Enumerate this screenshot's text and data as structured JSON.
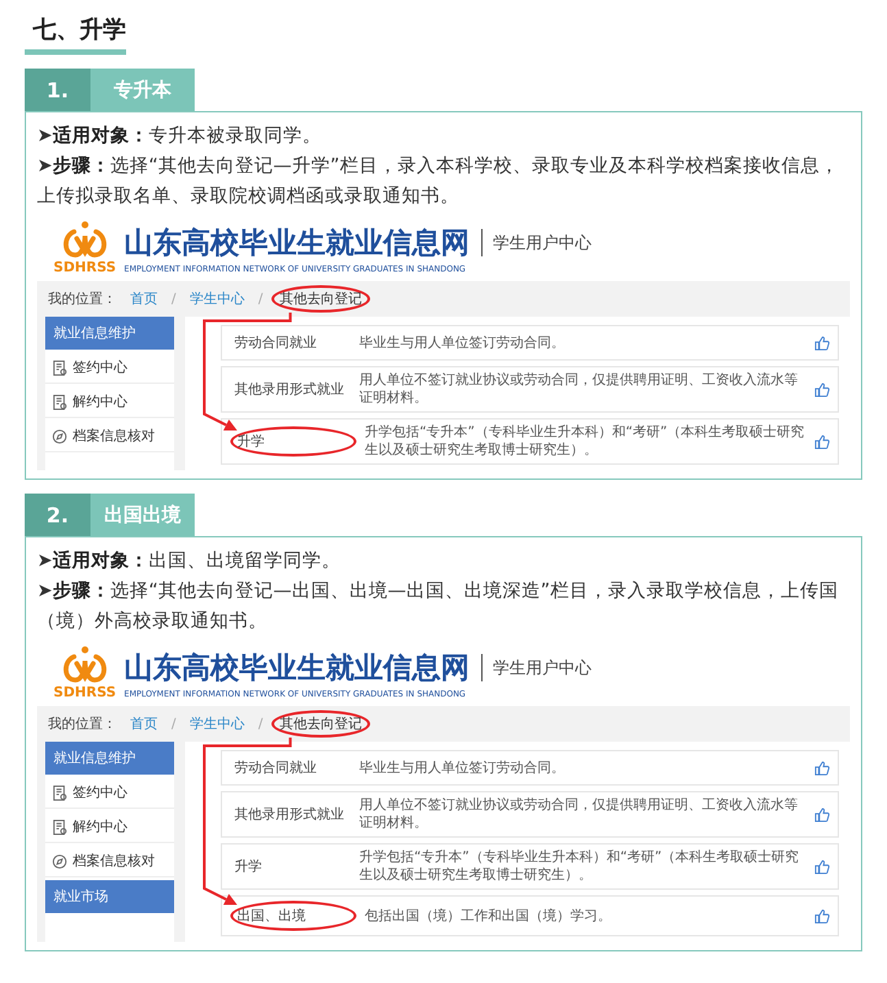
{
  "heading": "七、升学",
  "sections": [
    {
      "number": "1.",
      "title": "专升本",
      "paragraphs": [
        "➤**适用对象：**专升本被录取同学。",
        "➤**步骤：**选择“其他去向登记—升学”栏目，录入本科学校、录取专业及本科学校档案接收信息，上传拟录取名单、录取院校调档函或录取通知书。"
      ],
      "screenshot": {
        "logo_text": "SDHRSS",
        "site_title": "山东高校毕业生就业信息网",
        "site_subtitle": "学生用户中心",
        "site_english": "EMPLOYMENT INFORMATION NETWORK OF UNIVERSITY GRADUATES IN SHANDONG",
        "breadcrumb_label": "我的位置：",
        "breadcrumb_separator": "/",
        "breadcrumb": [
          {
            "text": "首页",
            "circled": false
          },
          {
            "text": "学生中心",
            "circled": false
          },
          {
            "text": "其他去向登记",
            "circled": true
          }
        ],
        "sidebar": [
          {
            "kind": "header",
            "label": "就业信息维护"
          },
          {
            "kind": "document",
            "label": "签约中心"
          },
          {
            "kind": "document",
            "label": "解约中心"
          },
          {
            "kind": "compass",
            "label": "档案信息核对"
          }
        ],
        "rows": [
          {
            "label": "劳动合同就业",
            "description": "毕业生与用人单位签订劳动合同。",
            "circled": false
          },
          {
            "label": "其他录用形式就业",
            "description": "用人单位不签订就业协议或劳动合同，仅提供聘用证明、工资收入流水等证明材料。",
            "circled": false
          },
          {
            "label": "升学",
            "description": "升学包括“专升本”（专科毕业生升本科）和“考研”（本科生考取硕士研究生以及硕士研究生考取博士研究生）。",
            "circled": true
          }
        ]
      }
    },
    {
      "number": "2.",
      "title": "出国出境",
      "paragraphs": [
        "➤**适用对象：**出国、出境留学同学。",
        "➤**步骤：**选择“其他去向登记—出国、出境—出国、出境深造”栏目，录入录取学校信息，上传国（境）外高校录取通知书。"
      ],
      "screenshot": {
        "logo_text": "SDHRSS",
        "site_title": "山东高校毕业生就业信息网",
        "site_subtitle": "学生用户中心",
        "site_english": "EMPLOYMENT INFORMATION NETWORK OF UNIVERSITY GRADUATES IN SHANDONG",
        "breadcrumb_label": "我的位置：",
        "breadcrumb_separator": "/",
        "breadcrumb": [
          {
            "text": "首页",
            "circled": false
          },
          {
            "text": "学生中心",
            "circled": false
          },
          {
            "text": "其他去向登记",
            "circled": true
          }
        ],
        "sidebar": [
          {
            "kind": "header",
            "label": "就业信息维护"
          },
          {
            "kind": "document",
            "label": "签约中心"
          },
          {
            "kind": "document",
            "label": "解约中心"
          },
          {
            "kind": "compass",
            "label": "档案信息核对"
          },
          {
            "kind": "header",
            "label": "就业市场"
          }
        ],
        "rows": [
          {
            "label": "劳动合同就业",
            "description": "毕业生与用人单位签订劳动合同。",
            "circled": false
          },
          {
            "label": "其他录用形式就业",
            "description": "用人单位不签订就业协议或劳动合同，仅提供聘用证明、工资收入流水等证明材料。",
            "circled": false
          },
          {
            "label": "升学",
            "description": "升学包括“专升本”（专科毕业生升本科）和“考研”（本科生考取硕士研究生以及硕士研究生考取博士研究生）。",
            "circled": false
          },
          {
            "label": "出国、出境",
            "description": "包括出国（境）工作和出国（境）学习。",
            "circled": true
          }
        ]
      }
    }
  ]
}
